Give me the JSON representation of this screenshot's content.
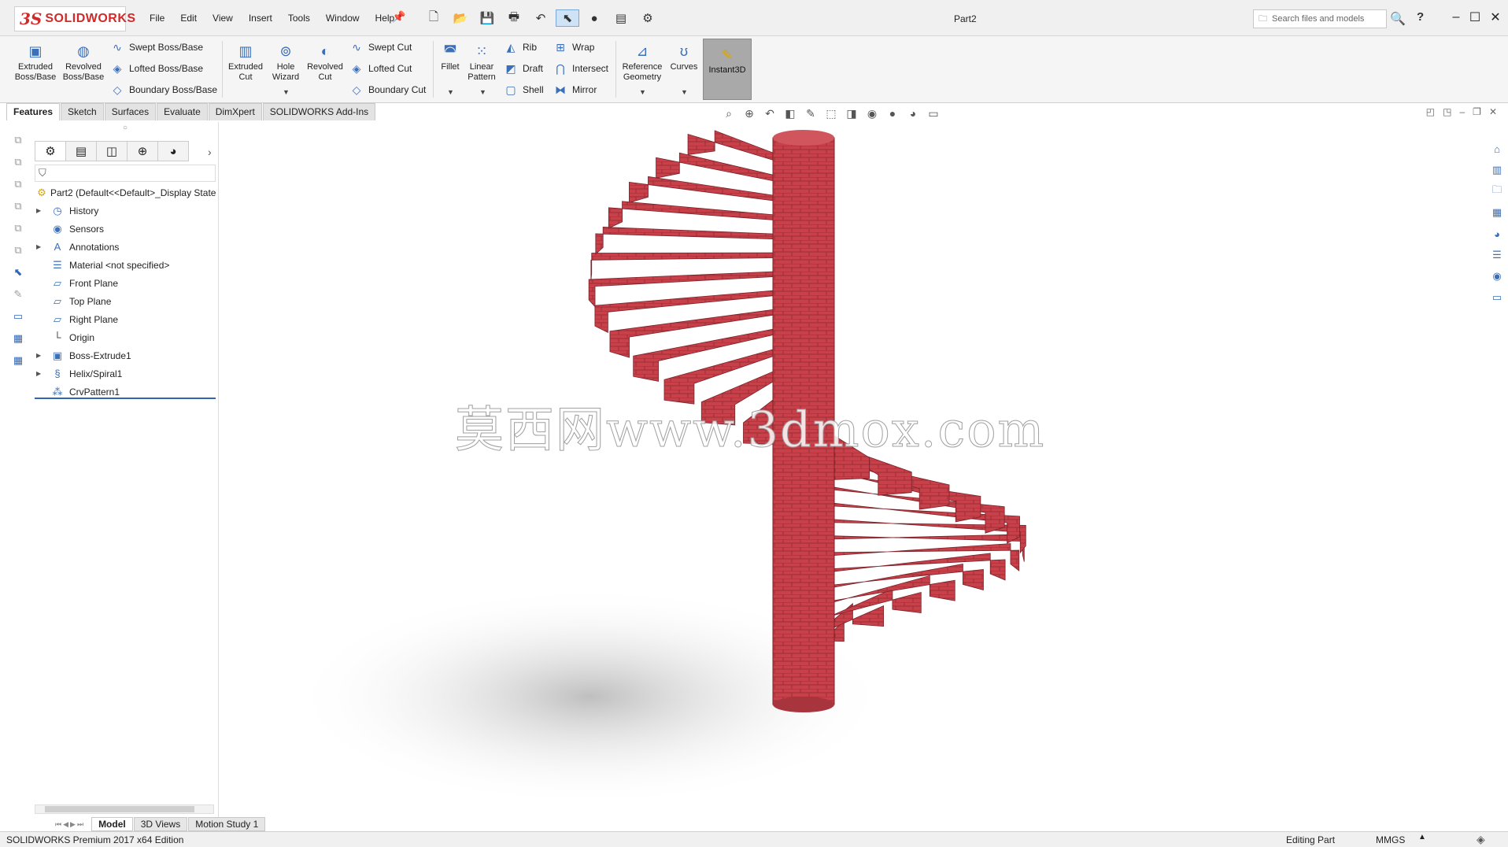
{
  "app": {
    "logo_text": "SOLIDWORKS",
    "doc_title": "Part2",
    "search_placeholder": "Search files and models"
  },
  "menu": [
    "File",
    "Edit",
    "View",
    "Insert",
    "Tools",
    "Window",
    "Help"
  ],
  "ribbon": {
    "extruded_boss": "Extruded Boss/Base",
    "revolved_boss": "Revolved Boss/Base",
    "swept_boss": "Swept Boss/Base",
    "lofted_boss": "Lofted Boss/Base",
    "boundary_boss": "Boundary Boss/Base",
    "extruded_cut": "Extruded Cut",
    "hole_wizard": "Hole Wizard",
    "revolved_cut": "Revolved Cut",
    "swept_cut": "Swept Cut",
    "lofted_cut": "Lofted Cut",
    "boundary_cut": "Boundary Cut",
    "fillet": "Fillet",
    "linear_pattern": "Linear Pattern",
    "rib": "Rib",
    "draft": "Draft",
    "shell": "Shell",
    "wrap": "Wrap",
    "intersect": "Intersect",
    "mirror": "Mirror",
    "reference_geometry": "Reference Geometry",
    "curves": "Curves",
    "instant3d": "Instant3D"
  },
  "tabs": [
    "Features",
    "Sketch",
    "Surfaces",
    "Evaluate",
    "DimXpert",
    "SOLIDWORKS Add-Ins"
  ],
  "feature_tree": {
    "root": "Part2  (Default<<Default>_Display State",
    "items": [
      {
        "label": "History",
        "expandable": true
      },
      {
        "label": "Sensors",
        "expandable": false
      },
      {
        "label": "Annotations",
        "expandable": true
      },
      {
        "label": "Material <not specified>",
        "expandable": false
      },
      {
        "label": "Front Plane",
        "expandable": false
      },
      {
        "label": "Top Plane",
        "expandable": false
      },
      {
        "label": "Right Plane",
        "expandable": false
      },
      {
        "label": "Origin",
        "expandable": false
      },
      {
        "label": "Boss-Extrude1",
        "expandable": true
      },
      {
        "label": "Helix/Spiral1",
        "expandable": true
      },
      {
        "label": "CrvPattern1",
        "expandable": false
      }
    ]
  },
  "bottom_tabs": [
    "Model",
    "3D Views",
    "Motion Study 1"
  ],
  "status": {
    "left": "SOLIDWORKS Premium 2017 x64 Edition",
    "mode": "Editing Part",
    "units": "MMGS"
  },
  "watermark": "莫西网www.3dmox.com",
  "colors": {
    "brick": "#c8414a",
    "brick_dark": "#8f2a31",
    "accent": "#2f66b8",
    "logo": "#d22a2a"
  }
}
